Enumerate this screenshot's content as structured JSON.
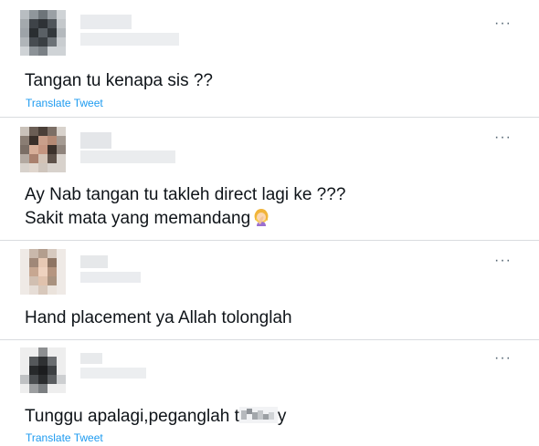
{
  "tweets": [
    {
      "lines": [
        "Tangan tu kenapa sis ??"
      ],
      "translate_label": "Translate Tweet",
      "more_icon": "more-horizontal-icon"
    },
    {
      "lines": [
        "Ay Nab tangan tu takleh direct lagi ke ???",
        "Sakit mata yang memandang"
      ],
      "emoji": "woman-facepalming-emoji",
      "more_icon": "more-horizontal-icon"
    },
    {
      "lines": [
        "Hand placement ya Allah tolonglah"
      ],
      "more_icon": "more-horizontal-icon"
    },
    {
      "lines": [
        "Tunggu apalagi,peganglah t",
        "y"
      ],
      "translate_label": "Translate Tweet",
      "more_icon": "more-horizontal-icon"
    }
  ],
  "more_glyph": "···",
  "colors": {
    "text": "#0f1419",
    "link": "#1d9bf0",
    "divider": "#d9dcdf",
    "muted": "#536471"
  }
}
